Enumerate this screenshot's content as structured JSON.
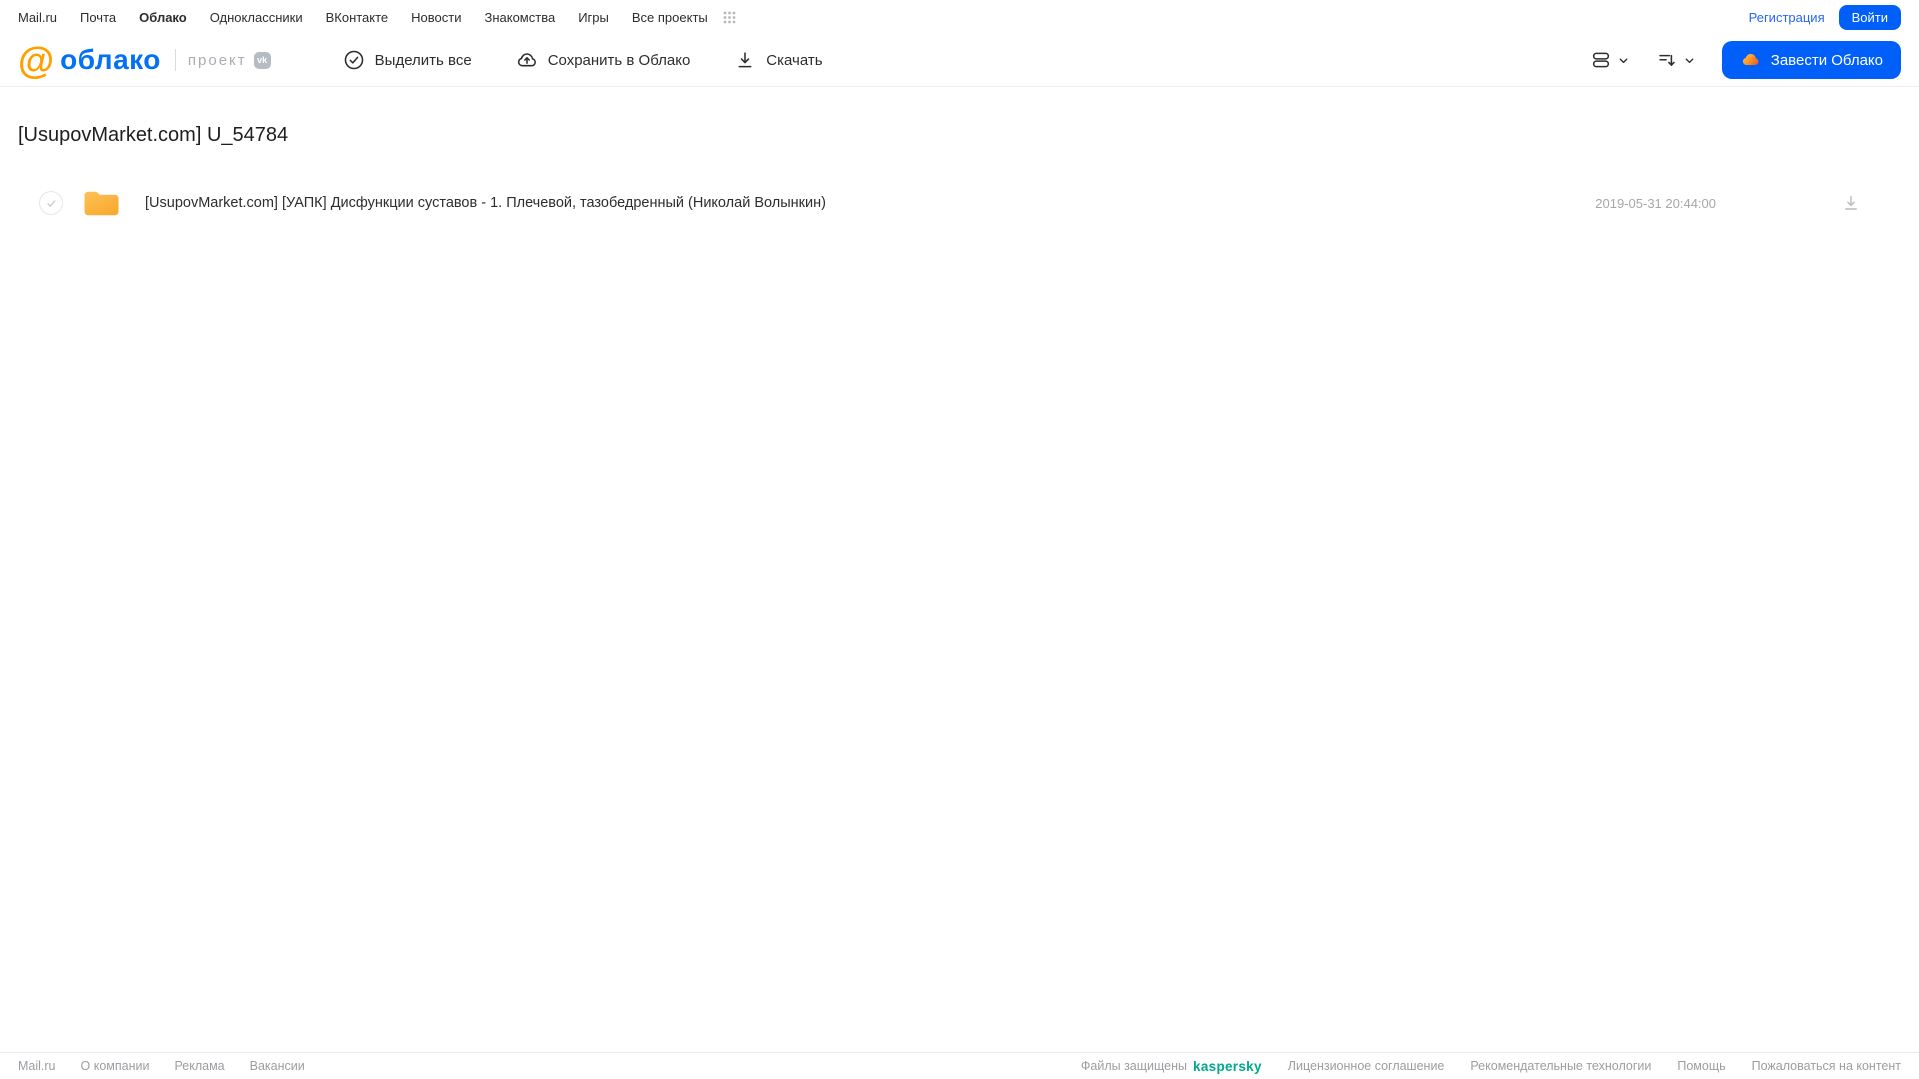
{
  "topnav": {
    "items": [
      "Mail.ru",
      "Почта",
      "Облако",
      "Одноклассники",
      "ВКонтакте",
      "Новости",
      "Знакомства",
      "Игры",
      "Все проекты"
    ],
    "active_item": "Облако",
    "registration": "Регистрация",
    "login": "Войти"
  },
  "header": {
    "logo": {
      "at": "@",
      "word": "облако"
    },
    "project_label": "проект",
    "vk_badge": "vk",
    "toolbar": {
      "select_all": "Выделить все",
      "save_to_cloud": "Сохранить в Облако",
      "download": "Скачать"
    },
    "icons": {
      "select_all": "check-circle-icon",
      "save_to_cloud": "cloud-upload-icon",
      "download": "download-icon",
      "view_mode": "list-rows-icon + chevron-down-icon",
      "sort": "sort-arrow-icon + chevron-down-icon",
      "cta": "cloud-icon",
      "apps": "grid-dots-icon"
    },
    "cta_label": "Завести Облако"
  },
  "main": {
    "title": "[UsupovMarket.com] U_54784",
    "files": [
      {
        "type": "folder",
        "name": "[UsupovMarket.com] [УАПК] Дисфункции суставов - 1. Плечевой, тазобедренный (Николай Волынкин)",
        "date": "2019-05-31 20:44:00"
      }
    ]
  },
  "footer": {
    "left_links": [
      "Mail.ru",
      "О компании",
      "Реклама",
      "Вакансии"
    ],
    "protected_label": "Файлы защищены",
    "kaspersky": "kaspersky",
    "right_links": [
      "Лицензионное соглашение",
      "Рекомендательные технологии",
      "Помощь",
      "Пожаловаться на контент"
    ]
  },
  "colors": {
    "accent_blue": "#005ff9",
    "logo_orange": "#ffa000",
    "logo_blue": "#0470f5",
    "folder_yellow": "#fbb23e",
    "kaspersky_teal": "#00a88e",
    "muted_gray": "#a5a7ab"
  }
}
